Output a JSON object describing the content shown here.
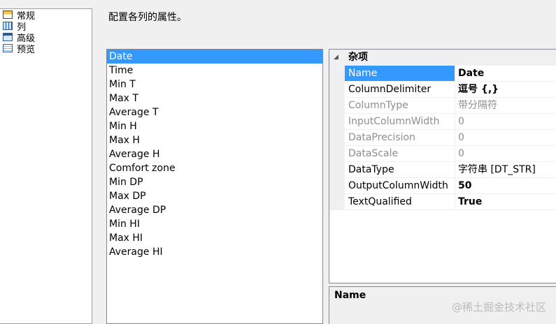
{
  "nav": {
    "items": [
      {
        "label": "常规",
        "icon": "general-settings-icon",
        "selected": false
      },
      {
        "label": "列",
        "icon": "columns-icon",
        "selected": false
      },
      {
        "label": "高级",
        "icon": "advanced-icon",
        "selected": true
      },
      {
        "label": "预览",
        "icon": "preview-icon",
        "selected": false
      }
    ]
  },
  "page": {
    "description": "配置各列的属性。"
  },
  "columns": [
    "Date",
    "Time",
    "Min T",
    "Max T",
    "Average T",
    "Min H",
    "Max H",
    "Average H",
    "Comfort zone",
    "Min DP",
    "Max DP",
    "Average DP",
    "Min HI",
    "Max HI",
    "Average HI"
  ],
  "selected_column": "Date",
  "property_grid": {
    "category": "杂项",
    "expand_glyph": "◢",
    "properties": [
      {
        "name": "Name",
        "value": "Date",
        "bold": true,
        "readonly": false,
        "selected": true
      },
      {
        "name": "ColumnDelimiter",
        "value": "逗号 {,}",
        "bold": true,
        "readonly": false,
        "selected": false
      },
      {
        "name": "ColumnType",
        "value": "带分隔符",
        "bold": false,
        "readonly": true,
        "selected": false
      },
      {
        "name": "InputColumnWidth",
        "value": "0",
        "bold": false,
        "readonly": true,
        "selected": false
      },
      {
        "name": "DataPrecision",
        "value": "0",
        "bold": false,
        "readonly": true,
        "selected": false
      },
      {
        "name": "DataScale",
        "value": "0",
        "bold": false,
        "readonly": true,
        "selected": false
      },
      {
        "name": "DataType",
        "value": "字符串 [DT_STR]",
        "bold": false,
        "readonly": false,
        "selected": false
      },
      {
        "name": "OutputColumnWidth",
        "value": "50",
        "bold": true,
        "readonly": false,
        "selected": false
      },
      {
        "name": "TextQualified",
        "value": "True",
        "bold": true,
        "readonly": false,
        "selected": false
      }
    ]
  },
  "description_pane": {
    "title": "Name"
  },
  "watermark": "@稀土掘金技术社区",
  "colors": {
    "selection": "#3399ff",
    "readonly_text": "#8e8e8e",
    "window_bg": "#f0f0f0"
  }
}
